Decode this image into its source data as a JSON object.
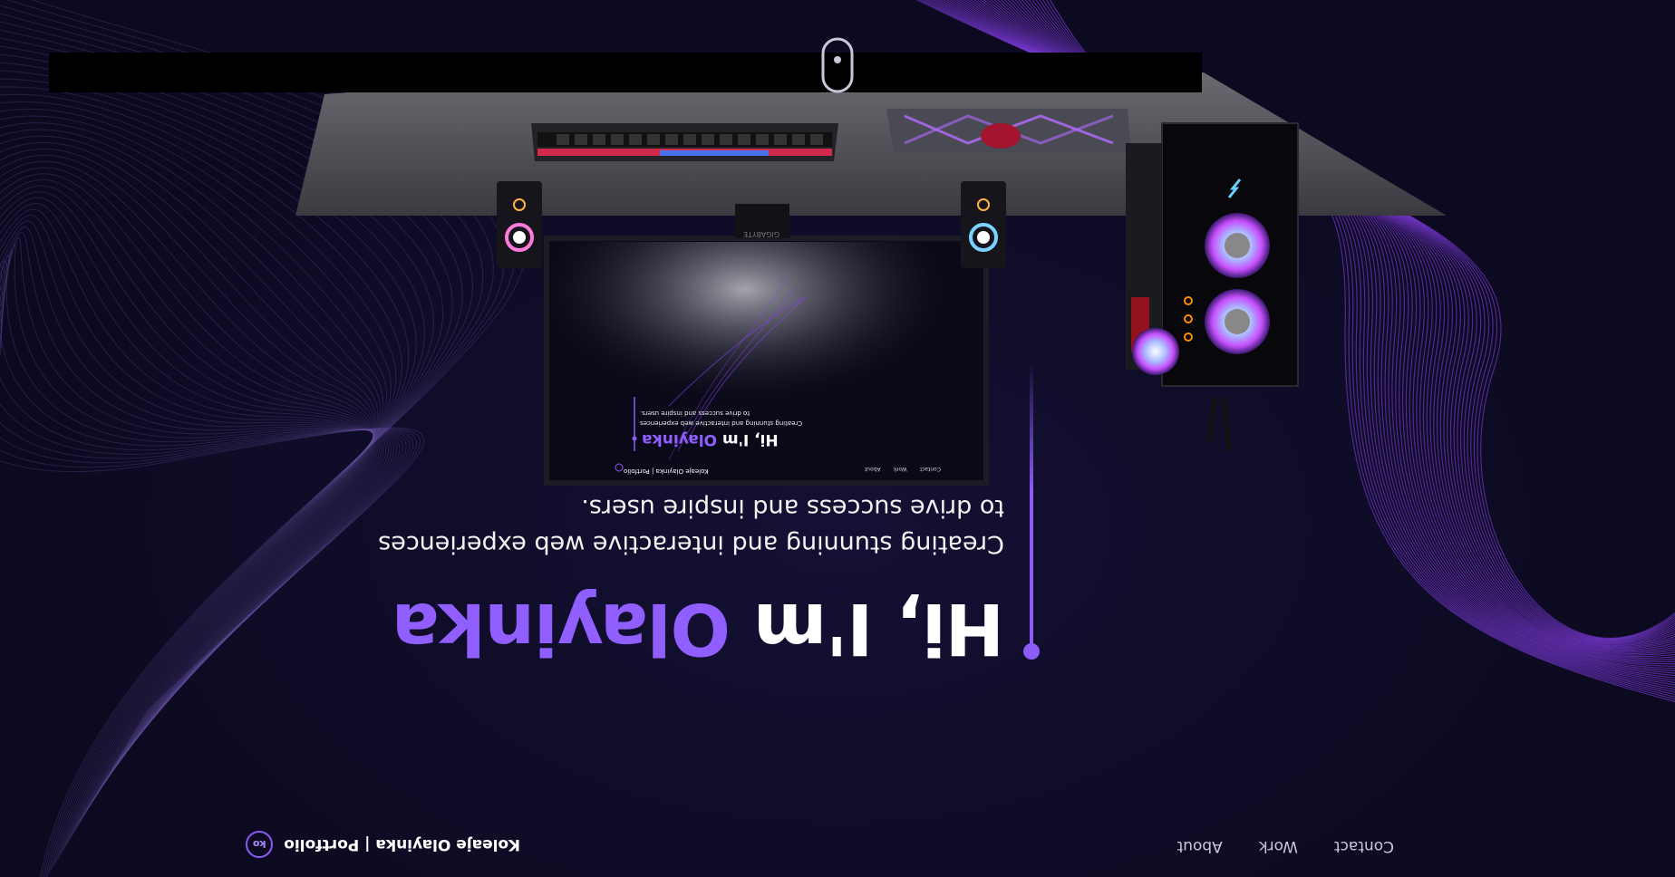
{
  "nav": {
    "brand_logo": "ko",
    "brand_text": "Koleaje Olayinka | Portfolio",
    "links": [
      "About",
      "Work",
      "Contact"
    ]
  },
  "hero": {
    "greeting": "Hi, I'm ",
    "name": "Olayinka",
    "subtitle_line1": "Creating stunning and interactive web experiences",
    "subtitle_line2": "to drive success and inspire users."
  },
  "monitor": {
    "brand": "GIGABYTE",
    "screen_brand_text": "Koleaje Olayinka | Portfolio",
    "screen_links": [
      "About",
      "Work",
      "Contact"
    ],
    "screen_greeting": "Hi, I'm ",
    "screen_name": "Olayinka",
    "screen_sub1": "Creating stunning and interactive web experiences",
    "screen_sub2": "to drive success and inspire users."
  },
  "scroll_indicator": "mouse-scroll-icon",
  "colors": {
    "background": "#0d0b22",
    "accent": "#915eff",
    "text": "#ffffff",
    "wave": "#7b3fe4"
  }
}
